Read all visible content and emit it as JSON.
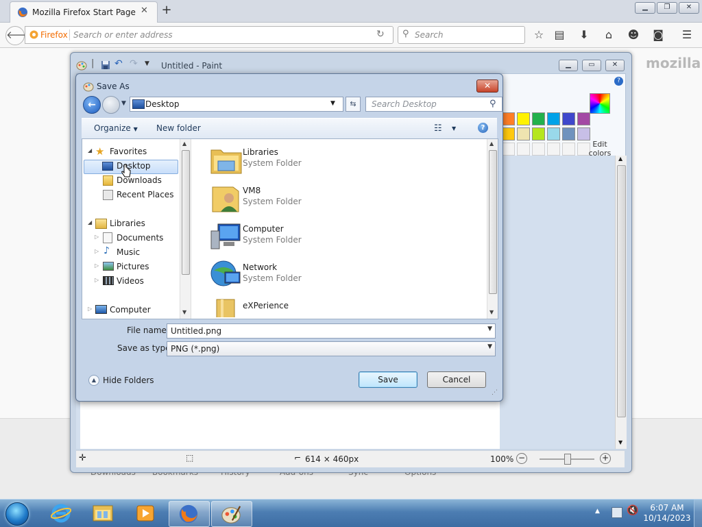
{
  "firefox": {
    "tab_title": "Mozilla Firefox Start Page",
    "url_brand": "Firefox",
    "url_placeholder": "Search or enter address",
    "search_placeholder": "Search",
    "logo_text": "mozilla",
    "launchers": [
      "Downloads",
      "Bookmarks",
      "History",
      "Add-ons",
      "Sync",
      "Options"
    ]
  },
  "paint": {
    "title": "Untitled - Paint",
    "edit_colors_label": "Edit colors",
    "status": {
      "dimensions": "614 × 460px",
      "zoom": "100%"
    },
    "palette_row1": [
      "#ff7f27",
      "#fff200",
      "#22b14c",
      "#00a2e8",
      "#3f48cc",
      "#a349a4"
    ],
    "palette_row2": [
      "#ffc90e",
      "#efe4b0",
      "#b5e61d",
      "#99d9ea",
      "#7092be",
      "#c8bfe7"
    ]
  },
  "saveas": {
    "title": "Save As",
    "location": "Desktop",
    "search_placeholder": "Search Desktop",
    "organize_label": "Organize",
    "new_folder_label": "New folder",
    "nav": {
      "favorites": "Favorites",
      "desktop": "Desktop",
      "downloads": "Downloads",
      "recent": "Recent Places",
      "libraries": "Libraries",
      "documents": "Documents",
      "music": "Music",
      "pictures": "Pictures",
      "videos": "Videos",
      "computer": "Computer"
    },
    "files": [
      {
        "name": "Libraries",
        "type": "System Folder"
      },
      {
        "name": "VM8",
        "type": "System Folder"
      },
      {
        "name": "Computer",
        "type": "System Folder"
      },
      {
        "name": "Network",
        "type": "System Folder"
      },
      {
        "name": "eXPerience",
        "type": ""
      }
    ],
    "file_name_label": "File name:",
    "file_name_value": "Untitled.png",
    "save_type_label": "Save as type:",
    "save_type_value": "PNG (*.png)",
    "hide_folders_label": "Hide Folders",
    "save_label": "Save",
    "cancel_label": "Cancel"
  },
  "taskbar": {
    "time": "6:07 AM",
    "date": "10/14/2023"
  }
}
